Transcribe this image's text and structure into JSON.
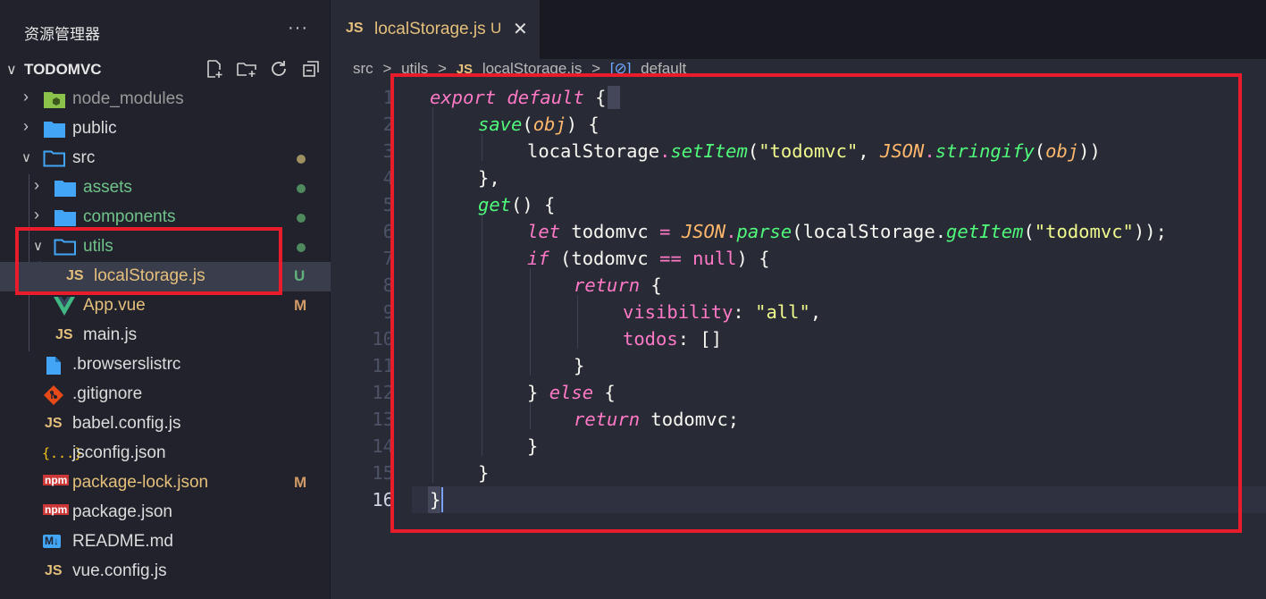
{
  "explorer": {
    "title": "资源管理器",
    "more": "···",
    "project": "TODOMVC",
    "items": [
      {
        "label": "node_modules",
        "icon": "node-folder-icon"
      },
      {
        "label": "public",
        "icon": "folder-icon"
      },
      {
        "label": "src",
        "icon": "folder-open-icon"
      },
      {
        "label": "assets",
        "icon": "folder-icon"
      },
      {
        "label": "components",
        "icon": "folder-icon"
      },
      {
        "label": "utils",
        "icon": "folder-open-icon"
      },
      {
        "label": "localStorage.js",
        "icon": "js-icon",
        "badge": "U"
      },
      {
        "label": "App.vue",
        "icon": "vue-icon",
        "badge": "M"
      },
      {
        "label": "main.js",
        "icon": "js-icon"
      },
      {
        "label": ".browserslistrc",
        "icon": "file-icon"
      },
      {
        "label": ".gitignore",
        "icon": "git-icon"
      },
      {
        "label": "babel.config.js",
        "icon": "js-icon"
      },
      {
        "label": "jsconfig.json",
        "icon": "json-icon"
      },
      {
        "label": "package-lock.json",
        "icon": "npm-icon",
        "badge": "M"
      },
      {
        "label": "package.json",
        "icon": "npm-icon"
      },
      {
        "label": "README.md",
        "icon": "markdown-icon"
      },
      {
        "label": "vue.config.js",
        "icon": "js-icon"
      }
    ]
  },
  "icons": {
    "js": "JS",
    "npm": "npm",
    "md": "M↓",
    "json": "{..}",
    "dotted_json": "{...}"
  },
  "tab": {
    "name": "localStorage.js",
    "status": "U",
    "close": "✕"
  },
  "breadcrumb": [
    "src",
    ">",
    "utils",
    ">",
    "localStorage.js",
    ">",
    "default"
  ],
  "line_numbers": [
    "1",
    "2",
    "3",
    "4",
    "5",
    "6",
    "7",
    "8",
    "9",
    "10",
    "11",
    "12",
    "13",
    "14",
    "15",
    "16"
  ],
  "code": {
    "l1": {
      "a": "export",
      "b": "default",
      "c": "{"
    },
    "l2": {
      "a": "save",
      "b": "(",
      "c": "obj",
      "d": ") {"
    },
    "l3": {
      "a": "localStorage",
      "b": ".",
      "c": "setItem",
      "d": "(",
      "e": "\"todomvc\"",
      "f": ", ",
      "g": "JSON",
      "h": ".",
      "i": "stringify",
      "j": "(",
      "k": "obj",
      "l": "))"
    },
    "l4": {
      "a": "},"
    },
    "l5": {
      "a": "get",
      "b": "() {"
    },
    "l6": {
      "a": "let",
      "b": " todomvc ",
      "c": "=",
      "d": " ",
      "e": "JSON",
      "f": ".",
      "g": "parse",
      "h": "(localStorage.",
      "i": "getItem",
      "j": "(",
      "k": "\"todomvc\"",
      "l": "));"
    },
    "l7": {
      "a": "if",
      "b": " (todomvc ",
      "c": "==",
      "d": " ",
      "e": "null",
      "f": ") {"
    },
    "l8": {
      "a": "return",
      "b": " {"
    },
    "l9": {
      "a": "visibility",
      "b": ": ",
      "c": "\"all\"",
      "d": ","
    },
    "l10": {
      "a": "todos",
      "b": ": []"
    },
    "l11": {
      "a": "}"
    },
    "l12": {
      "a": "} ",
      "b": "else",
      "c": " {"
    },
    "l13": {
      "a": "return",
      "b": " todomvc;"
    },
    "l14": {
      "a": "}"
    },
    "l15": {
      "a": "}"
    },
    "l16": {
      "a": "}"
    }
  },
  "colors": {
    "highlight": "#e81c2a",
    "keyword": "#ff79c6",
    "function": "#50fa7b",
    "string": "#f1fa8c",
    "param": "#ffb86c",
    "class": "#8be9fd"
  }
}
